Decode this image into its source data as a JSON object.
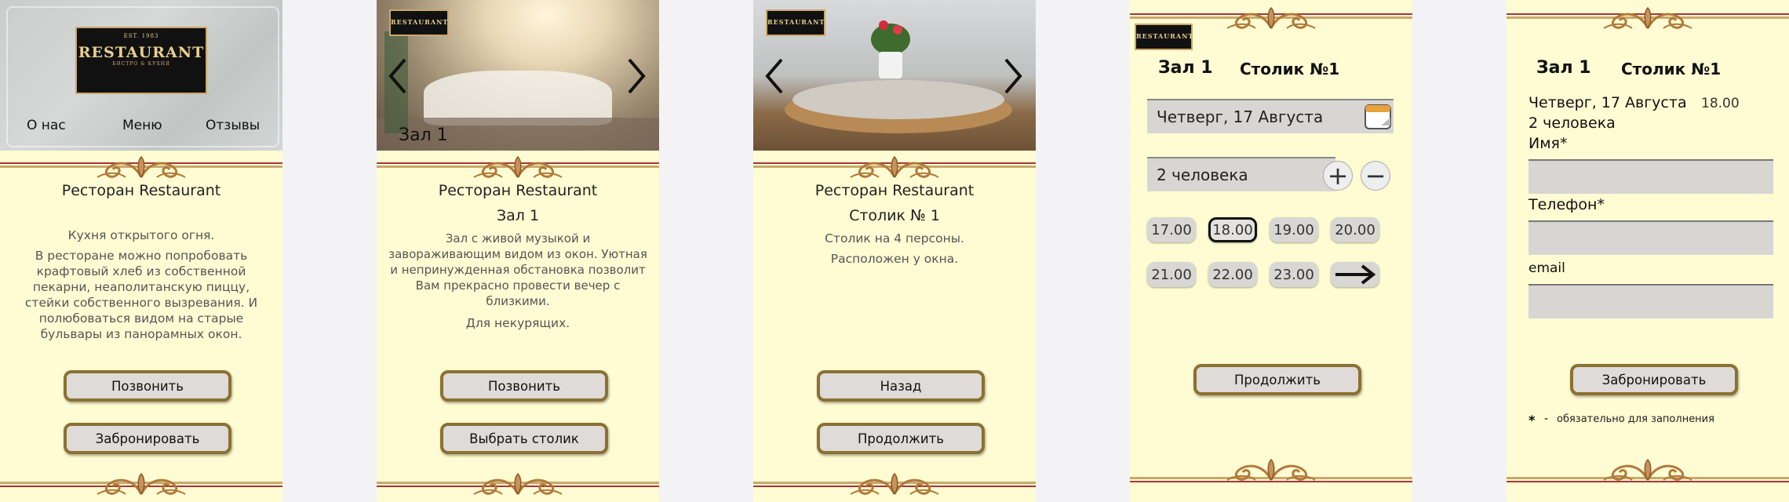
{
  "logo": {
    "est": "EST.   1983",
    "main": "RESTAURANT",
    "sub": "БИСТРО & КУХНЯ"
  },
  "screen1": {
    "nav": [
      "О нас",
      "Меню",
      "Отзывы"
    ],
    "title": "Ресторан Restaurant",
    "para1": "Кухня открытого огня.",
    "para2": "В ресторане можно попробовать крафтовый хлеб из собственной пекарни, неаполитанскую пиццу, стейки собственного вызревания. И полюбоваться видом на старые бульвары из панорамных окон.",
    "btn_call": "Позвонить",
    "btn_book": "Забронировать"
  },
  "screen2": {
    "hero_label": "Зал 1",
    "title": "Ресторан Restaurant",
    "subtitle": "Зал 1",
    "para1": "Зал с живой музыкой и завораживающим видом из окон. Уютная и непринужденная обстановка позволит Вам прекрасно провести вечер с близкими.",
    "para2": "Для некурящих.",
    "btn_call": "Позвонить",
    "btn_choose": "Выбрать столик"
  },
  "screen3": {
    "title": "Ресторан Restaurant",
    "subtitle": "Столик № 1",
    "para1": "Столик на 4 персоны.",
    "para2": "Расположен у окна.",
    "btn_back": "Назад",
    "btn_next": "Продолжить"
  },
  "screen4": {
    "hall": "Зал 1",
    "table": "Столик №1",
    "date": "Четверг, 17 Августа",
    "guests": "2 человека",
    "times": [
      "17.00",
      "18.00",
      "19.00",
      "20.00",
      "21.00",
      "22.00",
      "23.00"
    ],
    "selected_time": "18.00",
    "btn_next": "Продолжить"
  },
  "screen5": {
    "hall": "Зал 1",
    "table": "Столик №1",
    "date": "Четверг, 17 Августа",
    "time": "18.00",
    "guests": "2 человека",
    "name_label": "Имя*",
    "phone_label": "Телефон*",
    "email_label": "email",
    "btn_book": "Забронировать",
    "required_star": "*",
    "required_dash": "-",
    "required_note": "обязательно для заполнения"
  },
  "colors": {
    "bg": "#fffcd3",
    "accent": "#8b7132",
    "border_red": "#a8343a",
    "button": "#dedbd8"
  }
}
